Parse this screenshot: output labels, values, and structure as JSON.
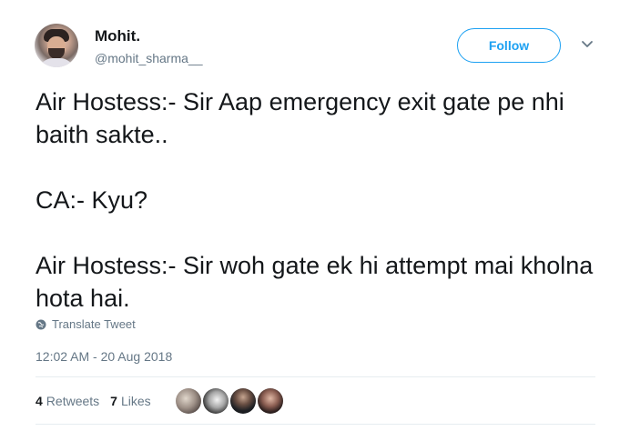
{
  "author": {
    "name": "Mohit.",
    "handle": "@mohit_sharma__"
  },
  "actions": {
    "follow_label": "Follow"
  },
  "tweet": {
    "text": "Air Hostess:- Sir Aap emergency exit gate pe nhi baith sakte..\n\nCA:- Kyu?\n\nAir Hostess:- Sir woh gate ek hi attempt mai kholna hota hai.",
    "translate_label": "Translate Tweet",
    "timestamp": "12:02 AM - 20 Aug 2018"
  },
  "stats": {
    "retweets_count": "4",
    "retweets_label": "Retweets",
    "likes_count": "7",
    "likes_label": "Likes"
  },
  "icons": {
    "globe": "globe-icon",
    "more": "chevron-down-icon"
  },
  "colors": {
    "accent": "#1da1f2",
    "secondary_text": "#657786",
    "primary_text": "#14171a"
  }
}
